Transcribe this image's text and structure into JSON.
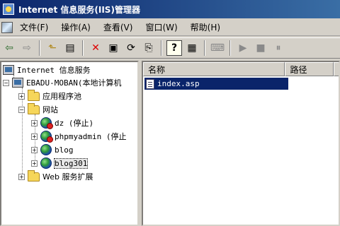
{
  "window": {
    "title": "Internet 信息服务(IIS)管理器"
  },
  "menu": {
    "items": [
      "文件(F)",
      "操作(A)",
      "查看(V)",
      "窗口(W)",
      "帮助(H)"
    ]
  },
  "toolbar": {
    "buttons": [
      {
        "name": "back-icon",
        "glyph": "⇦"
      },
      {
        "name": "forward-icon",
        "glyph": "⇨"
      },
      {
        "name": "up-folder-icon",
        "glyph": "⬑"
      },
      {
        "name": "show-hide-tree-icon",
        "glyph": "▤"
      },
      {
        "name": "delete-icon",
        "glyph": "✕"
      },
      {
        "name": "properties-icon",
        "glyph": "▣"
      },
      {
        "name": "refresh-icon",
        "glyph": "⟳"
      },
      {
        "name": "export-list-icon",
        "glyph": "⎘"
      },
      {
        "name": "help-icon",
        "glyph": "?"
      },
      {
        "name": "console-icon",
        "glyph": "▦"
      },
      {
        "name": "computer-icon",
        "glyph": "⌨"
      },
      {
        "name": "start-icon",
        "glyph": "▶"
      },
      {
        "name": "stop-icon",
        "glyph": "■"
      },
      {
        "name": "pause-icon",
        "glyph": "⏸"
      }
    ]
  },
  "tree": {
    "root": "Internet 信息服务",
    "server": "EBADU-MOBAN(本地计算机",
    "app_pools": "应用程序池",
    "websites": "网站",
    "sites": [
      "dz (停止)",
      "phpmyadmin (停止",
      "blog",
      "blog301"
    ],
    "web_ext": "Web 服务扩展"
  },
  "list": {
    "columns": [
      "名称",
      "路径"
    ],
    "rows": [
      {
        "name": "index.asp"
      }
    ]
  }
}
